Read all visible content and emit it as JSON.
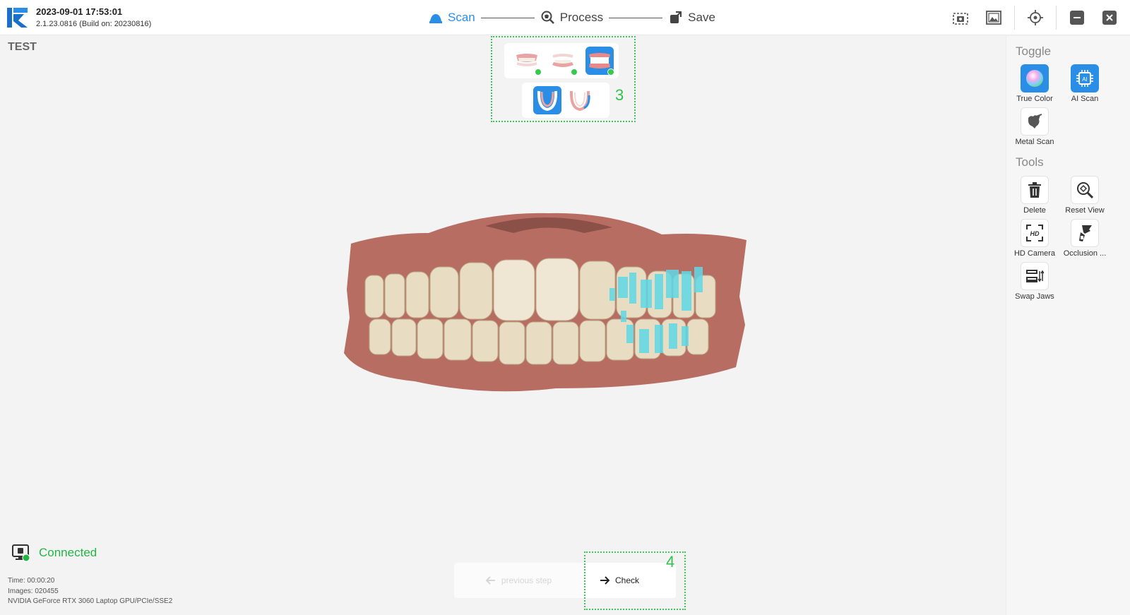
{
  "header": {
    "datetime": "2023-09-01 17:53:01",
    "version": "2.1.23.0816 (Build on: 20230816)",
    "steps": [
      {
        "label": "Scan",
        "icon": "scan-icon",
        "active": true
      },
      {
        "label": "Process",
        "icon": "process-icon",
        "active": false
      },
      {
        "label": "Save",
        "icon": "save-icon",
        "active": false
      }
    ],
    "accent_color": "#2b8ee6"
  },
  "viewport": {
    "project_name": "TEST",
    "jaw_hint_number": "3",
    "check_hint_number": "4"
  },
  "toggle": {
    "title": "Toggle",
    "items": [
      {
        "label": "True Color",
        "icon": "true-color-icon",
        "on": true
      },
      {
        "label": "AI Scan",
        "icon": "ai-scan-icon",
        "on": true
      },
      {
        "label": "Metal Scan",
        "icon": "metal-scan-icon",
        "on": false
      }
    ]
  },
  "tools": {
    "title": "Tools",
    "items": [
      {
        "label": "Delete",
        "icon": "trash-icon"
      },
      {
        "label": "Reset View",
        "icon": "reset-view-icon"
      },
      {
        "label": "HD Camera",
        "icon": "hd-camera-icon"
      },
      {
        "label": "Occlusion ...",
        "icon": "occlusion-icon"
      },
      {
        "label": "Swap Jaws",
        "icon": "swap-jaws-icon"
      }
    ]
  },
  "status": {
    "connection": "Connected",
    "time": "Time: 00:00:20",
    "images": "Images: 020455",
    "gpu": "NVIDIA GeForce RTX 3060 Laptop GPU/PCIe/SSE2",
    "connected_color": "#22b544"
  },
  "nav": {
    "previous_label": "previous step",
    "check_label": "Check"
  }
}
